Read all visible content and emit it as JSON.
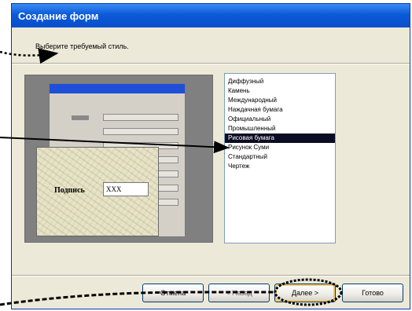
{
  "window": {
    "title": "Создание форм"
  },
  "instruction": "Выберите требуемый стиль.",
  "preview": {
    "field_label": "Подпись",
    "field_value": "XXX"
  },
  "style_list": {
    "items": [
      "Диффузный",
      "Камень",
      "Международный",
      "Наждачная бумага",
      "Официальный",
      "Промышленный",
      "Рисовая бумага",
      "Рисунок Суми",
      "Стандартный",
      "Чертеж"
    ],
    "selected_index": 6
  },
  "buttons": {
    "cancel": "Отмена",
    "back": "< Назад",
    "next": "Далее >",
    "finish": "Готово"
  },
  "colors": {
    "title_bar": "#0b5ad8",
    "dialog_bg": "#ece9d8",
    "selection": "#0b0b23"
  }
}
